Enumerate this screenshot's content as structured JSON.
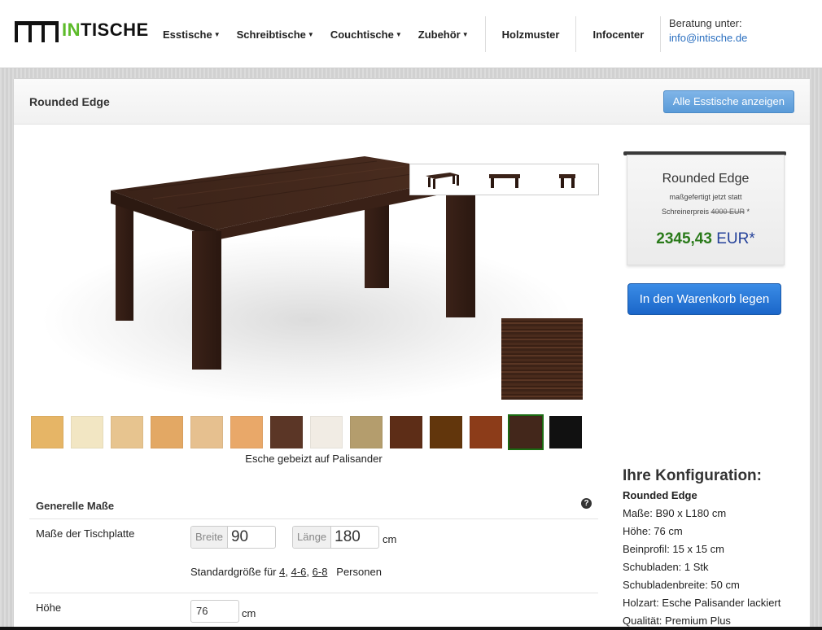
{
  "logo": {
    "in": "IN",
    "rest": "TISCHE"
  },
  "nav": {
    "items": [
      {
        "label": "Esstische",
        "dropdown": true
      },
      {
        "label": "Schreibtische",
        "dropdown": true
      },
      {
        "label": "Couchtische",
        "dropdown": true
      },
      {
        "label": "Zubehör",
        "dropdown": true
      }
    ],
    "links": [
      "Holzmuster",
      "Infocenter"
    ],
    "consult_label": "Beratung unter:",
    "consult_email": "info@intische.de"
  },
  "panel": {
    "title": "Rounded Edge",
    "show_all_button": "Alle Esstische anzeigen"
  },
  "price": {
    "name": "Rounded Edge",
    "subtitle": "maßgefertigt jetzt statt",
    "old_prefix": "Schreinerpreis",
    "old_price": "4000 EUR",
    "old_suffix": "*",
    "amount": "2345,43",
    "currency": "EUR*",
    "cart_button": "In den Warenkorb legen"
  },
  "swatches": {
    "colors": [
      "#e6b566",
      "#f2e6c3",
      "#e7c48f",
      "#e3a864",
      "#e6c08f",
      "#e9a869",
      "#5b3626",
      "#f1ece4",
      "#b49d6d",
      "#5d2d17",
      "#62360c",
      "#8c3c19",
      "#43271b",
      "#111111"
    ],
    "selected_index": 12,
    "caption": "Esche gebeizt auf Palisander"
  },
  "form": {
    "section_title": "Generelle Maße",
    "help": "?",
    "row1_label": "Maße der Tischplatte",
    "breite_label": "Breite",
    "breite_value": "90",
    "laenge_label": "Länge",
    "laenge_value": "180",
    "unit": "cm",
    "std_prefix": "Standardgröße für",
    "std_links": [
      "4",
      "4-6",
      "6-8"
    ],
    "std_suffix": "Personen",
    "row2_label": "Höhe",
    "hoehe_value": "76",
    "hoehe_unit": "cm"
  },
  "config": {
    "title": "Ihre Konfiguration:",
    "name": "Rounded Edge",
    "lines": [
      "Maße: B90 x L180 cm",
      "Höhe: 76 cm",
      "Beinprofil: 15 x 15 cm",
      "Schubladen: 1 Stk",
      "Schubladenbreite: 50 cm",
      "Holzart: Esche Palisander lackiert",
      "Qualität: Premium Plus"
    ]
  },
  "icons": {
    "help": "help-icon",
    "caret": "caret-down-icon"
  },
  "colors": {
    "accent": "#5dbb2a",
    "price_green": "#2a7a1a",
    "price_blue": "#24419a",
    "button_blue": "#1b66c9"
  }
}
